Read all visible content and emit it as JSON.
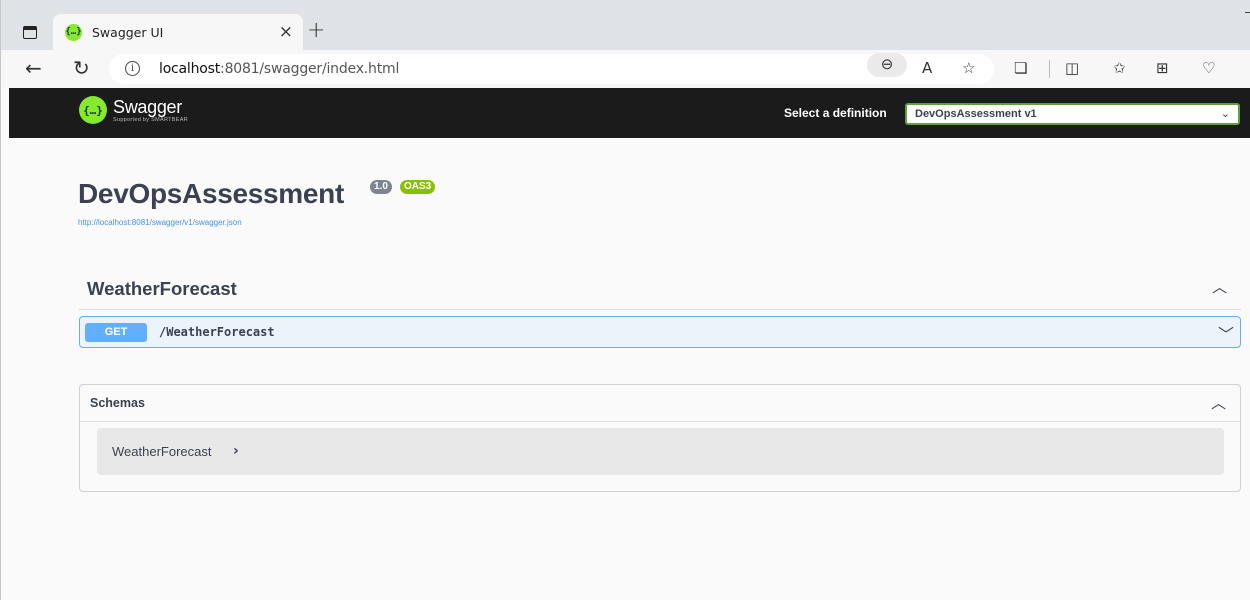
{
  "browser": {
    "tab_title": "Swagger UI",
    "tab_close": "×",
    "new_tab": "+",
    "url_host": "localhost",
    "url_path": ":8081/swagger/index.html",
    "info_glyph": "i",
    "icons": {
      "back": "←",
      "reload": "↻",
      "zoom": "⊖",
      "read_aloud": "A",
      "favorite": "☆",
      "extensions": "❏",
      "split_screen": "◫",
      "favorites_bar": "✩",
      "collections": "⊞",
      "health": "♡"
    }
  },
  "topbar": {
    "logo_mark": "{…}",
    "logo_name": "Swagger",
    "logo_sub": "Supported by SMARTBEAR",
    "select_label": "Select a definition",
    "selected_definition": "DevOpsAssessment v1",
    "select_arrow": "⌄"
  },
  "info": {
    "title": "DevOpsAssessment",
    "version_badge": "1.0",
    "oas_badge": "OAS3",
    "spec_url": "http://localhost:8081/swagger/v1/swagger.json"
  },
  "tags": [
    {
      "name": "WeatherForecast",
      "toggle": "︿",
      "operations": [
        {
          "method": "GET",
          "path": "/WeatherForecast",
          "toggle": "﹀"
        }
      ]
    }
  ],
  "schemas": {
    "title": "Schemas",
    "toggle": "︿",
    "models": [
      {
        "name": "WeatherForecast",
        "arrow": "›"
      }
    ]
  },
  "colors": {
    "topbar_bg": "#1b1b1b",
    "swagger_green": "#85ea2d",
    "get_blue": "#61affe",
    "get_bg": "#ebf3fb",
    "oas_badge": "#89bf04",
    "version_badge": "#7d8492",
    "text_primary": "#3b4151",
    "link_blue": "#4990e2"
  }
}
